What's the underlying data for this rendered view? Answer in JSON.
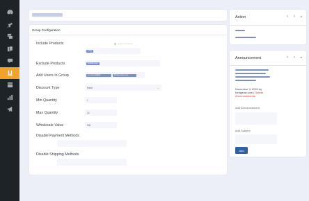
{
  "sidebar": {
    "icons": [
      "dashboard-icon",
      "pin-icon",
      "media-icon",
      "pages-icon",
      "comments-icon",
      "shop-icon",
      "grid-icon",
      "stats-icon",
      "megaphone-icon"
    ],
    "active_index": 5
  },
  "main": {
    "section_title": "Group Configuration",
    "fields": {
      "include_products": {
        "label": "Include Products",
        "radio_text": "Rule // Unsaved",
        "tag": "A Tag"
      },
      "exclude_products": {
        "label": "Exclude Products",
        "tag": "Exclude items"
      },
      "add_users": {
        "label": "Add Users In Group",
        "tag1": "ct.ut.mo.pop@gm",
        "tag2": "Product name here"
      },
      "discount_type": {
        "label": "Discount Type",
        "value": "Fixed"
      },
      "min_quantity": {
        "label": "Min Quantity",
        "value": "1"
      },
      "max_quantity": {
        "label": "Max Quantity",
        "value": "10"
      },
      "wholesale_value": {
        "label": "Wholesale Value",
        "value": "100"
      },
      "disable_payment": {
        "label": "Disable Payment Methods"
      },
      "disable_shipping": {
        "label": "Disable Shipping Methods"
      }
    }
  },
  "action_panel": {
    "title": "Action",
    "controls": [
      "˅",
      "˄",
      "▴"
    ]
  },
  "announcement_panel": {
    "title": "Announcement",
    "controls": [
      "˅",
      "˄",
      "▴"
    ],
    "meta_line1": "November 3, 2024 by",
    "meta_line2": "fordgmail.com |",
    "meta_link": "Delete",
    "meta_line3": "Announcements",
    "add_announcement_label": "Add Announcement",
    "add_subject_label": "Add Subject",
    "add_button": "Add"
  }
}
